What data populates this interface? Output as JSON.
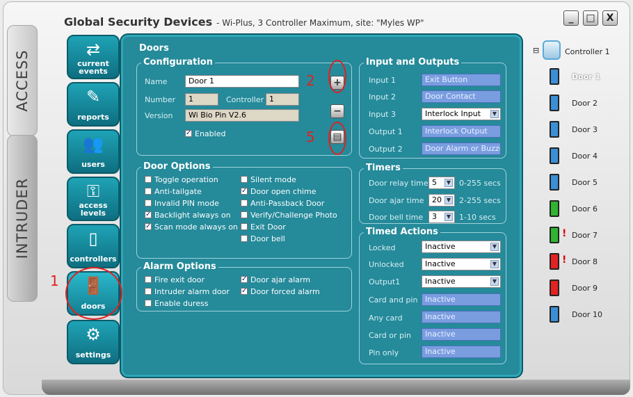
{
  "app": {
    "title": "Global Security Devices",
    "subtitle": "- Wi-Plus, 3 Controller Maximum, site: \"Myles WP\"",
    "section_access": "ACCESS",
    "section_intruder": "INTRUDER"
  },
  "window_controls": {
    "minimize": "_",
    "restore": "□",
    "close": "X"
  },
  "nav": [
    {
      "label": "current events",
      "icon": "⇄"
    },
    {
      "label": "reports",
      "icon": "✎"
    },
    {
      "label": "users",
      "icon": "👥"
    },
    {
      "label": "access levels",
      "icon": "⚿"
    },
    {
      "label": "controllers",
      "icon": "▯"
    },
    {
      "label": "doors",
      "icon": "🚪"
    },
    {
      "label": "settings",
      "icon": "⚙"
    }
  ],
  "panel": {
    "title": "Doors"
  },
  "configuration": {
    "title": "Configuration",
    "name_label": "Name",
    "name_value": "Door 1",
    "number_label": "Number",
    "number_value": "1",
    "controller_label": "Controller",
    "controller_value": "1",
    "version_label": "Version",
    "version_value": "Wi Bio Pin V2.6",
    "enabled_label": "Enabled",
    "enabled": true
  },
  "side_buttons": {
    "add": "+",
    "remove": "−",
    "save": "▤"
  },
  "annotations": {
    "a1": "1",
    "a2": "2",
    "a5": "5"
  },
  "io": {
    "title": "Input and Outputs",
    "rows": [
      {
        "label": "Input 1",
        "value": "Exit Button",
        "kind": "text"
      },
      {
        "label": "Input 2",
        "value": "Door Contact",
        "kind": "text"
      },
      {
        "label": "Input 3",
        "value": "Interlock Input",
        "kind": "select"
      },
      {
        "label": "Output 1",
        "value": "Interlock Output",
        "kind": "text"
      },
      {
        "label": "Output 2",
        "value": "Door Alarm or Buzzer",
        "kind": "text"
      }
    ]
  },
  "door_options": {
    "title": "Door Options",
    "col1": [
      {
        "label": "Toggle operation",
        "checked": false
      },
      {
        "label": "Anti-tailgate",
        "checked": false
      },
      {
        "label": "Invalid PIN mode",
        "checked": false
      },
      {
        "label": "Backlight always on",
        "checked": true
      },
      {
        "label": "Scan mode always on",
        "checked": true
      }
    ],
    "col2": [
      {
        "label": "Silent mode",
        "checked": false
      },
      {
        "label": "Door open chime",
        "checked": true
      },
      {
        "label": "Anti-Passback Door",
        "checked": false
      },
      {
        "label": "Verify/Challenge Photo",
        "checked": false
      },
      {
        "label": "Exit Door",
        "checked": false
      },
      {
        "label": "Door bell",
        "checked": false
      }
    ]
  },
  "timers": {
    "title": "Timers",
    "rows": [
      {
        "label": "Door relay time",
        "value": "5",
        "range": "0-255 secs"
      },
      {
        "label": "Door ajar time",
        "value": "20",
        "range": "2-255 secs"
      },
      {
        "label": "Door bell time",
        "value": "3",
        "range": "1-10 secs"
      }
    ]
  },
  "alarm_options": {
    "title": "Alarm Options",
    "col1": [
      {
        "label": "Fire exit door",
        "checked": false
      },
      {
        "label": "Intruder alarm door",
        "checked": false
      },
      {
        "label": "Enable duress",
        "checked": false
      }
    ],
    "col2": [
      {
        "label": "Door ajar alarm",
        "checked": true
      },
      {
        "label": "Door forced alarm",
        "checked": true
      }
    ]
  },
  "timed_actions": {
    "title": "Timed Actions",
    "rows": [
      {
        "label": "Locked",
        "value": "Inactive",
        "kind": "select"
      },
      {
        "label": "Unlocked",
        "value": "Inactive",
        "kind": "select"
      },
      {
        "label": "Output1",
        "value": "Inactive",
        "kind": "select"
      },
      {
        "label": "Card and pin",
        "value": "Inactive",
        "kind": "text"
      },
      {
        "label": "Any card",
        "value": "Inactive",
        "kind": "text"
      },
      {
        "label": "Card or pin",
        "value": "Inactive",
        "kind": "text"
      },
      {
        "label": "Pin only",
        "value": "Inactive",
        "kind": "text"
      }
    ]
  },
  "tree": {
    "controller": "Controller 1",
    "expander": "⊟",
    "doors": [
      {
        "label": "Door 1",
        "color": "#3a8fd6",
        "alert": false
      },
      {
        "label": "Door 2",
        "color": "#3a8fd6",
        "alert": false
      },
      {
        "label": "Door 3",
        "color": "#3a8fd6",
        "alert": false
      },
      {
        "label": "Door 4",
        "color": "#3a8fd6",
        "alert": false
      },
      {
        "label": "Door 5",
        "color": "#3a8fd6",
        "alert": false
      },
      {
        "label": "Door 6",
        "color": "#2fb52f",
        "alert": false
      },
      {
        "label": "Door 7",
        "color": "#2fb52f",
        "alert": true
      },
      {
        "label": "Door 8",
        "color": "#e32222",
        "alert": true
      },
      {
        "label": "Door 9",
        "color": "#e32222",
        "alert": false
      },
      {
        "label": "Door 10",
        "color": "#3a8fd6",
        "alert": false
      }
    ],
    "alert_mark": "!"
  }
}
